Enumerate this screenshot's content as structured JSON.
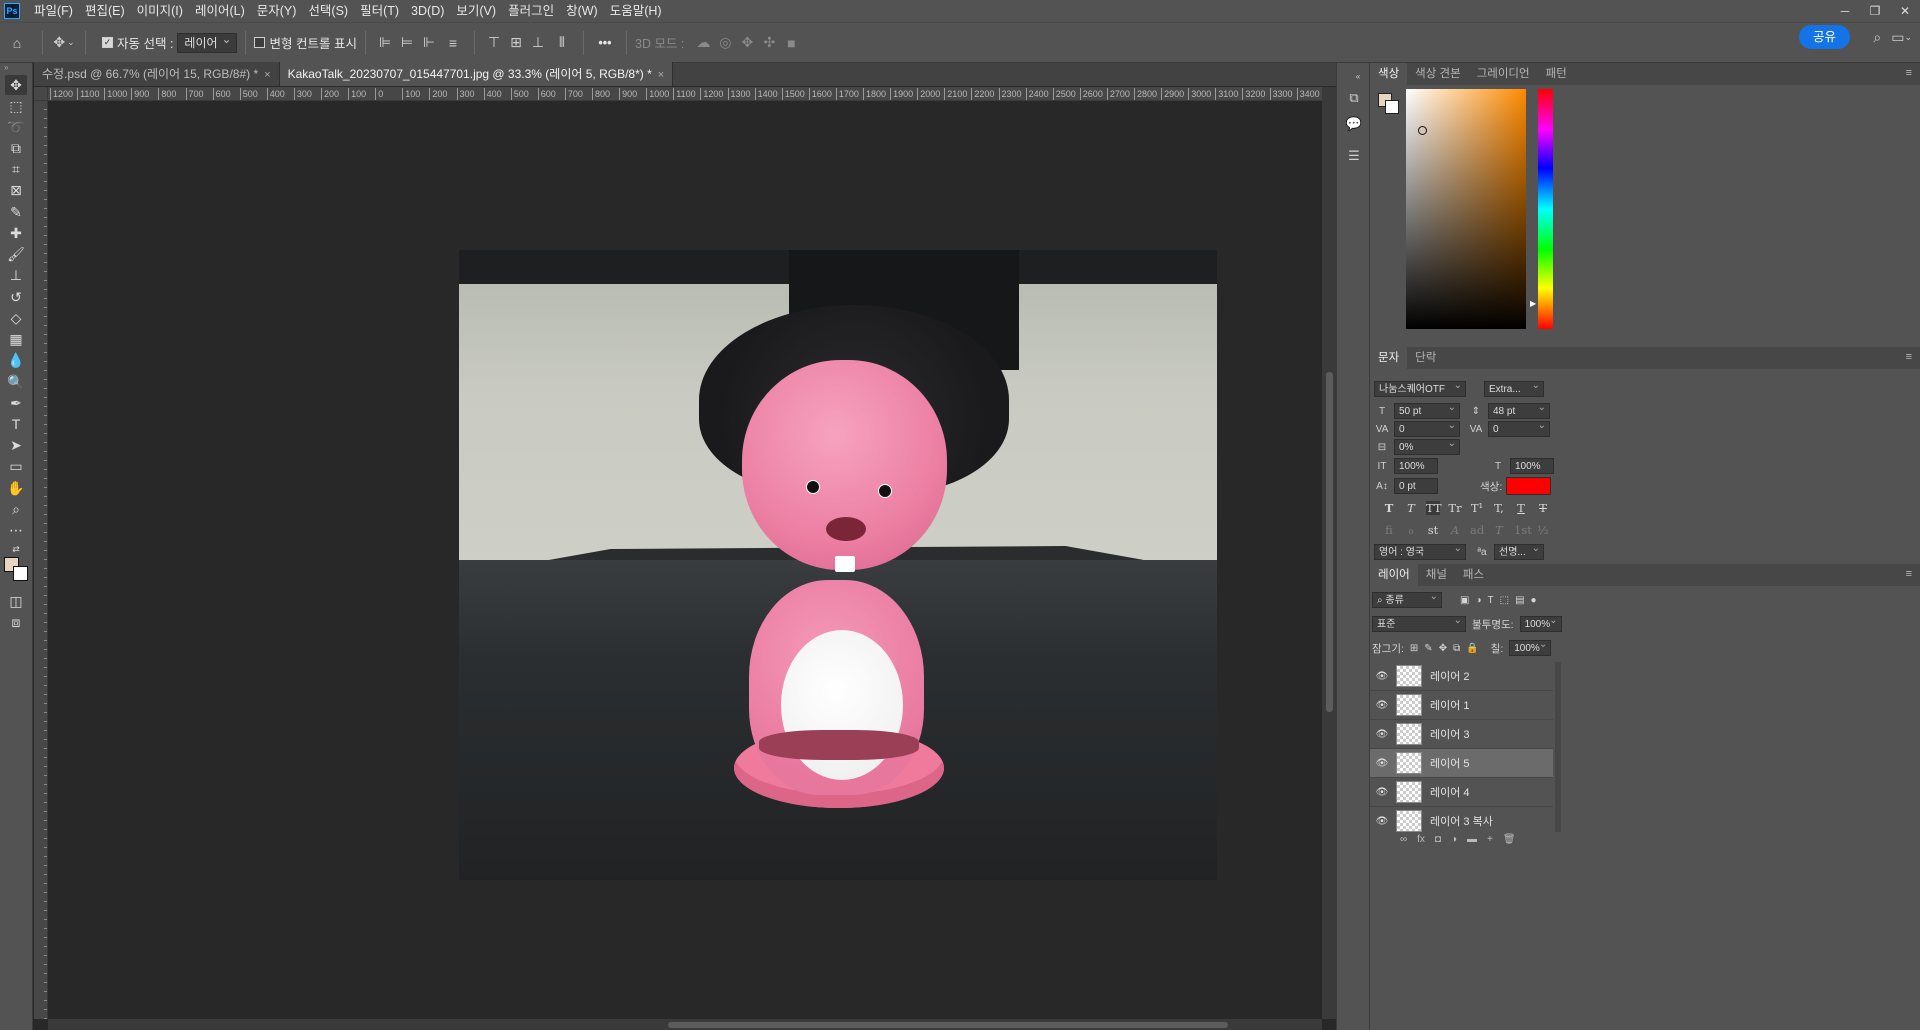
{
  "app": {
    "logo": "Ps",
    "menu": [
      "파일(F)",
      "편집(E)",
      "이미지(I)",
      "레이어(L)",
      "문자(Y)",
      "선택(S)",
      "필터(T)",
      "3D(D)",
      "보기(V)",
      "플러그인",
      "창(W)",
      "도움말(H)"
    ],
    "window_controls": [
      "─",
      "❐",
      "✕"
    ]
  },
  "options_bar": {
    "auto_select_label": "자동 선택 :",
    "auto_select_checked": true,
    "auto_select_target": "레이어",
    "transform_controls_label": "변형 컨트롤 표시",
    "more": "•••",
    "mode_3d_label": "3D 모드 :",
    "share_label": "공유"
  },
  "tabs": [
    {
      "label": "수정.psd @ 66.7% (레이어 15, RGB/8#) *",
      "active": false,
      "close": "×"
    },
    {
      "label": "KakaoTalk_20230707_015447701.jpg @ 33.3% (레이어 5, RGB/8*) *",
      "active": true,
      "close": "×"
    }
  ],
  "ruler_labels": [
    "1200",
    "1100",
    "1000",
    "900",
    "800",
    "700",
    "600",
    "500",
    "400",
    "300",
    "200",
    "100",
    "0",
    "100",
    "200",
    "300",
    "400",
    "500",
    "600",
    "700",
    "800",
    "900",
    "1000",
    "1100",
    "1200",
    "1300",
    "1400",
    "1500",
    "1600",
    "1700",
    "1800",
    "1900",
    "2000",
    "2100",
    "2200",
    "2300",
    "2400",
    "2500",
    "2600",
    "2700",
    "2800",
    "2900",
    "3000",
    "3100",
    "3200",
    "3300",
    "3400"
  ],
  "tools": [
    "move-icon",
    "marquee-icon",
    "lasso-icon",
    "object-select-icon",
    "crop-icon",
    "frame-icon",
    "eyedropper-icon",
    "healing-icon",
    "brush-icon",
    "stamp-icon",
    "history-brush-icon",
    "eraser-icon",
    "gradient-icon",
    "blur-icon",
    "dodge-icon",
    "pen-icon",
    "type-icon",
    "path-select-icon",
    "rectangle-icon",
    "hand-icon",
    "zoom-icon",
    "more-tools-icon"
  ],
  "colors": {
    "foreground": "#e8d5bf",
    "background": "#ffffff",
    "text_color": "#ff0000",
    "accent": "#1473e6"
  },
  "color_panel": {
    "tabs": [
      "색상",
      "색상 견본",
      "그레이디언",
      "패턴"
    ]
  },
  "char_panel": {
    "tabs": [
      "문자",
      "단락"
    ],
    "font_family": "나눔스퀘어OTF",
    "font_style": "Extra...",
    "font_size": "50 pt",
    "leading": "48 pt",
    "kerning": "0",
    "tracking": "0",
    "tsume": "0%",
    "vertical_scale": "100%",
    "horizontal_scale": "100%",
    "baseline_shift": "0 pt",
    "color_label": "색상:",
    "language": "영어 : 영국",
    "aa_icon": "ªa",
    "antialias": "선명...",
    "style_buttons": [
      "T",
      "T",
      "TT",
      "Tr",
      "T¹",
      "T,",
      "T",
      "T"
    ],
    "opentype_buttons": [
      "fi",
      "ℴ",
      "st",
      "A",
      "ad",
      "T",
      "1st",
      "½"
    ]
  },
  "layers_panel": {
    "tabs": [
      "레이어",
      "채널",
      "패스"
    ],
    "filter_label": "종류",
    "blend_mode": "표준",
    "opacity_label": "불투명도:",
    "opacity": "100%",
    "lock_label": "잠그기:",
    "fill_label": "칠:",
    "fill": "100%",
    "layers": [
      {
        "name": "레이어 2",
        "selected": false
      },
      {
        "name": "레이어 1",
        "selected": false
      },
      {
        "name": "레이어 3",
        "selected": false
      },
      {
        "name": "레이어 5",
        "selected": true
      },
      {
        "name": "레이어 4",
        "selected": false
      },
      {
        "name": "레이어 3 복사",
        "selected": false
      }
    ],
    "bottom_icons": [
      "∞",
      "fx",
      "◘",
      "◑",
      "▬",
      "+",
      "🗑"
    ]
  }
}
